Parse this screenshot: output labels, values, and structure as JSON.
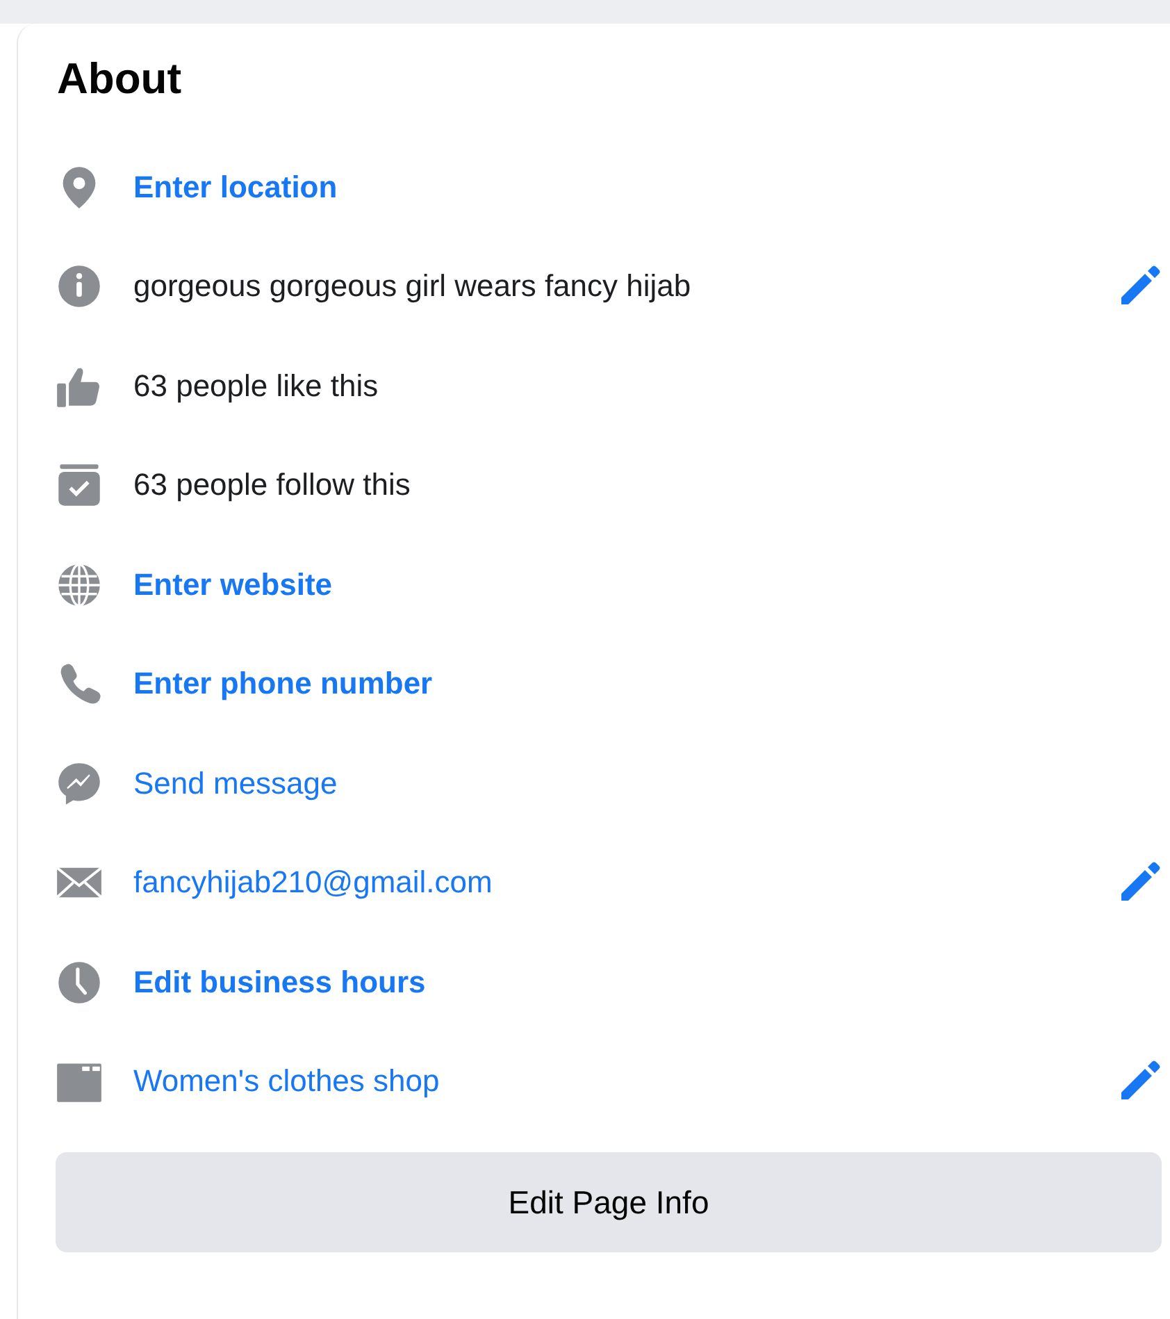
{
  "card": {
    "title": "About",
    "rows": [
      {
        "kind": "prompt",
        "text": "Enter location",
        "editable": false
      },
      {
        "kind": "plain",
        "text": "gorgeous gorgeous girl wears fancy hijab",
        "editable": true
      },
      {
        "kind": "plain",
        "text": "63 people like this",
        "editable": false
      },
      {
        "kind": "plain",
        "text": "63 people follow this",
        "editable": false
      },
      {
        "kind": "prompt",
        "text": "Enter website",
        "editable": false
      },
      {
        "kind": "prompt",
        "text": "Enter phone number",
        "editable": false
      },
      {
        "kind": "link",
        "text": "Send message",
        "editable": false
      },
      {
        "kind": "link",
        "text": "fancyhijab210@gmail.com",
        "editable": true
      },
      {
        "kind": "prompt",
        "text": "Edit business hours",
        "editable": false
      },
      {
        "kind": "link",
        "text": "Women's clothes shop",
        "editable": true
      }
    ],
    "button": "Edit Page Info"
  }
}
